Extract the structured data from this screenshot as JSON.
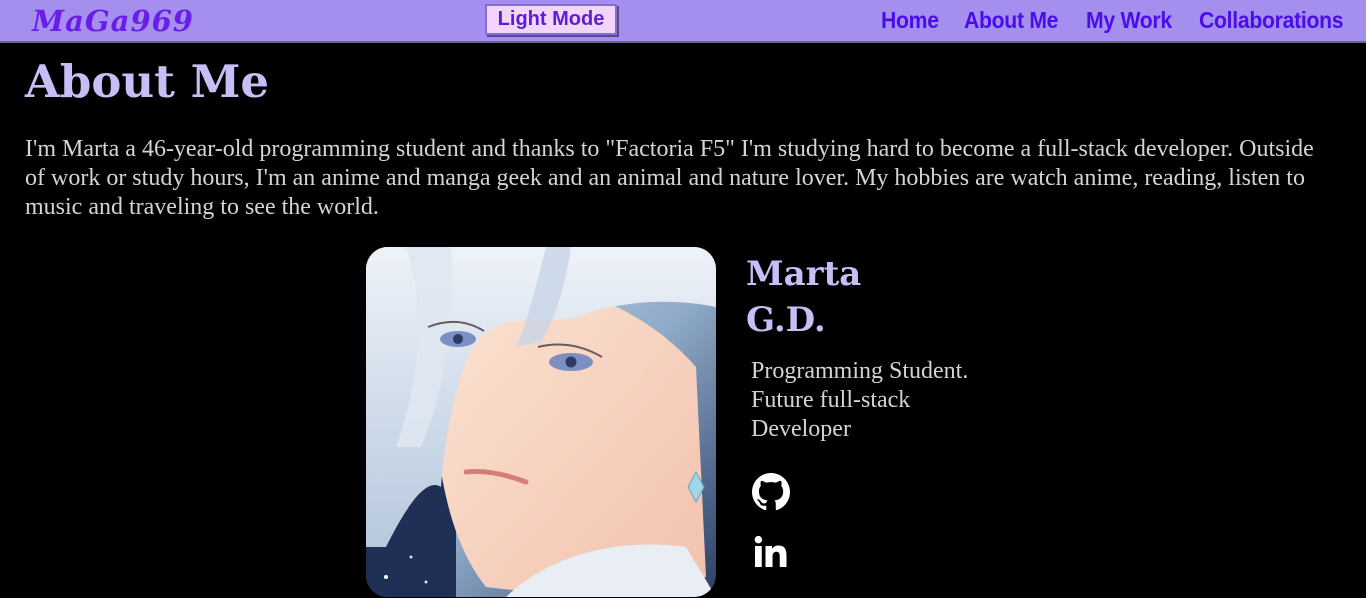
{
  "nav": {
    "logo": "MaGa969",
    "mode_button": "Light Mode",
    "links": [
      "Home",
      "About Me",
      "My Work",
      "Collaborations"
    ]
  },
  "about": {
    "title": "About Me",
    "intro": "I'm Marta a 46-year-old programming student and thanks to \"Factoria F5\" I'm studying hard to become a full-stack developer. Outside of work or study hours, I'm an anime and manga geek and an animal and nature lover. My hobbies are watch anime, reading, listen to music and traveling to see the world."
  },
  "profile": {
    "name_line1": "Marta",
    "name_line2": "G.D.",
    "role_line1": "Programming Student.",
    "role_line2": "Future full-stack",
    "role_line3": "Developer",
    "avatar_icon": "anime-portrait-illustration",
    "social": [
      "github-icon",
      "linkedin-icon"
    ]
  },
  "colors": {
    "navbar_bg": "#a48fef",
    "nav_text": "#4b0de9",
    "heading": "#c9bdf6",
    "body_text": "#d4d4d4",
    "page_bg": "#000000"
  }
}
